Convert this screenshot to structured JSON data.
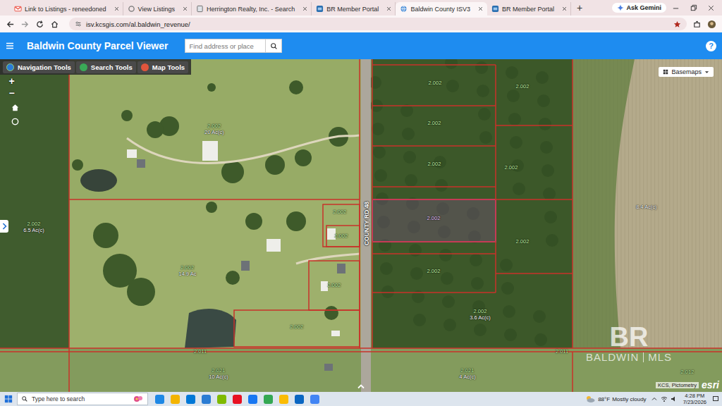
{
  "browser": {
    "tabs": [
      {
        "label": "Link to Listings - reneedoned",
        "selected": false,
        "kind": "mail"
      },
      {
        "label": "View Listings",
        "selected": false,
        "kind": "ring"
      },
      {
        "label": "Herrington Realty, Inc. - Search",
        "selected": false,
        "kind": "page"
      },
      {
        "label": "BR Member Portal",
        "selected": false,
        "kind": "br"
      },
      {
        "label": "Baldwin County ISV3",
        "selected": true,
        "kind": "globe"
      },
      {
        "label": "BR Member Portal",
        "selected": false,
        "kind": "br"
      }
    ],
    "new_tab": "+",
    "ask_gemini": "Ask Gemini",
    "url": "isv.kcsgis.com/al.baldwin_revenue/"
  },
  "app": {
    "title": "Baldwin County Parcel Viewer",
    "search_placeholder": "Find address or place",
    "help": "?",
    "tools": [
      "Navigation Tools",
      "Search Tools",
      "Map Tools"
    ],
    "basemaps": "Basemaps",
    "zoom_in": "+",
    "zoom_out": "−"
  },
  "map": {
    "road": "COUNTY RD 48",
    "parcels": [
      {
        "number": "2.002",
        "selected": false
      },
      {
        "number": "2.002",
        "selected": false
      },
      {
        "number": "2.002",
        "selected": false
      },
      {
        "number": "2.002",
        "selected": false
      },
      {
        "number": "2.002",
        "selected": false
      },
      {
        "number": "2.002",
        "selected": true
      },
      {
        "number": "2.002",
        "selected": false
      },
      {
        "number": "2.002",
        "selected": false
      },
      {
        "number": "2.002",
        "acres": "3.6 Ac(c)",
        "selected": false
      },
      {
        "number": "2.002",
        "acres": "20 Ac(c)",
        "selected": false
      },
      {
        "number": "2.002",
        "acres": "6.5 Ac(c)",
        "selected": false
      },
      {
        "number": "2.002",
        "acres": "14.9 Ac",
        "selected": false
      },
      {
        "number": "2.002",
        "selected": false
      },
      {
        "number": "2.002",
        "selected": false
      },
      {
        "number": "2.002",
        "selected": false
      },
      {
        "number": "2.002",
        "selected": false
      },
      {
        "acres": "8.4 Ac(c)",
        "selected": false
      },
      {
        "number": "2.011",
        "selected": false
      },
      {
        "number": "2.011",
        "selected": false
      },
      {
        "number": "2.021",
        "acres": "10 Ac(c)",
        "selected": false
      },
      {
        "number": "2.021",
        "acres": "4 Ac(c)",
        "selected": false
      },
      {
        "number": "2.012",
        "selected": false
      }
    ],
    "watermark": {
      "logo": "BR",
      "left": "BALDWIN",
      "right": "MLS"
    },
    "attribution": "KCS, Pictometry",
    "esri": "esri"
  },
  "taskbar": {
    "search_placeholder": "Type here to search",
    "temperature": "88°F",
    "weather": "Mostly cloudy",
    "time": "4:28 PM",
    "date": "7/23/2026"
  }
}
